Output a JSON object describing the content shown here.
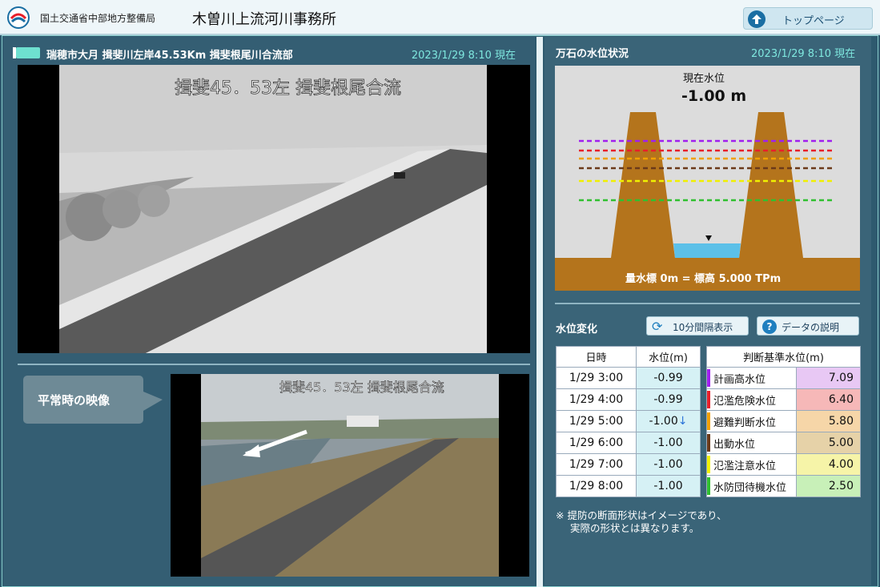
{
  "header": {
    "org": "国土交通省中部地方整備局",
    "office": "木曽川上流河川事務所",
    "top_button": "トップページ"
  },
  "camera": {
    "title": "瑞穂市大月 揖斐川左岸45.53Km 揖斐根尾川合流部",
    "timestamp": "2023/1/29 8:10 現在",
    "overlay": "揖斐45．53左 揖斐根尾合流",
    "normal_label": "平常時の映像",
    "normal_overlay": "揖斐45．53左 揖斐根尾合流"
  },
  "water_status": {
    "title": "万石の水位状況",
    "timestamp": "2023/1/29 8:10 現在",
    "current_label": "現在水位",
    "current_value": "-1.00 m",
    "gauge_note": "量水標 0m = 標高 5.000 TPm",
    "line_colors": [
      "#a020f0",
      "#e8202a",
      "#f0a000",
      "#6b3a1a",
      "#f0f000",
      "#30c030"
    ]
  },
  "changes": {
    "title": "水位変化",
    "btn_interval": "10分間隔表示",
    "btn_explain": "データの説明",
    "col_time": "日時",
    "col_level": "水位(m)",
    "rows": [
      {
        "time": "1/29 3:00",
        "level": "-0.99",
        "trend": ""
      },
      {
        "time": "1/29 4:00",
        "level": "-0.99",
        "trend": ""
      },
      {
        "time": "1/29 5:00",
        "level": "-1.00",
        "trend": "↓"
      },
      {
        "time": "1/29 6:00",
        "level": "-1.00",
        "trend": ""
      },
      {
        "time": "1/29 7:00",
        "level": "-1.00",
        "trend": ""
      },
      {
        "time": "1/29 8:00",
        "level": "-1.00",
        "trend": ""
      }
    ],
    "criteria_header": "判断基準水位(m)",
    "criteria": [
      {
        "name": "計画高水位",
        "value": "7.09",
        "color": "#a020f0",
        "bg": "#e8c8f4"
      },
      {
        "name": "氾濫危険水位",
        "value": "6.40",
        "color": "#e8202a",
        "bg": "#f6b8b8"
      },
      {
        "name": "避難判断水位",
        "value": "5.80",
        "color": "#f0a000",
        "bg": "#f6d6a8"
      },
      {
        "name": "出動水位",
        "value": "5.00",
        "color": "#6b3a1a",
        "bg": "#e6d2a8"
      },
      {
        "name": "氾濫注意水位",
        "value": "4.00",
        "color": "#f0f000",
        "bg": "#f6f4a8"
      },
      {
        "name": "水防団待機水位",
        "value": "2.50",
        "color": "#30c030",
        "bg": "#c8f0b8"
      }
    ],
    "note_line1": "※ 提防の断面形状はイメージであり、",
    "note_line2": "実際の形状とは異なります。"
  }
}
